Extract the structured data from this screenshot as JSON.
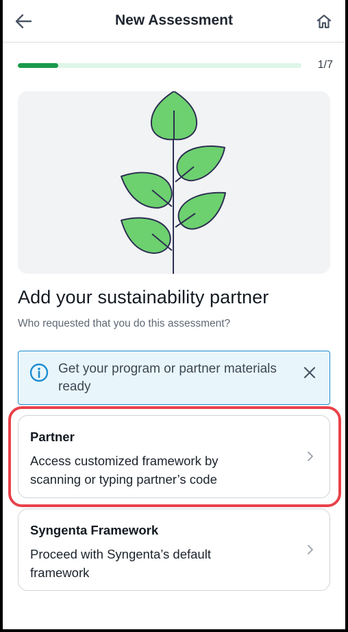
{
  "header": {
    "title": "New Assessment",
    "back_icon": "arrow-left-icon",
    "home_icon": "home-icon"
  },
  "progress": {
    "label": "1/7",
    "fraction": 0.1428,
    "fill_color": "#1a9b4a",
    "track_color": "#def5e7"
  },
  "illustration": {
    "icon": "leaf-branch-illustration",
    "leaf_color": "#6dd16f"
  },
  "main": {
    "heading": "Add your sustainability partner",
    "subheading": "Who requested that you do this assessment?"
  },
  "info_banner": {
    "text": "Get your program or partner materials ready",
    "icon": "info-icon",
    "close_icon": "close-icon",
    "border_color": "#1c8ccf",
    "background": "#e8f6fc"
  },
  "options": [
    {
      "title": "Partner",
      "description": "Access customized framework by scanning or typing partner’s code",
      "highlighted": true
    },
    {
      "title": "Syngenta Framework",
      "description": "Proceed with Syngenta’s default framework",
      "highlighted": false
    }
  ],
  "highlight_color": "#e8424a"
}
